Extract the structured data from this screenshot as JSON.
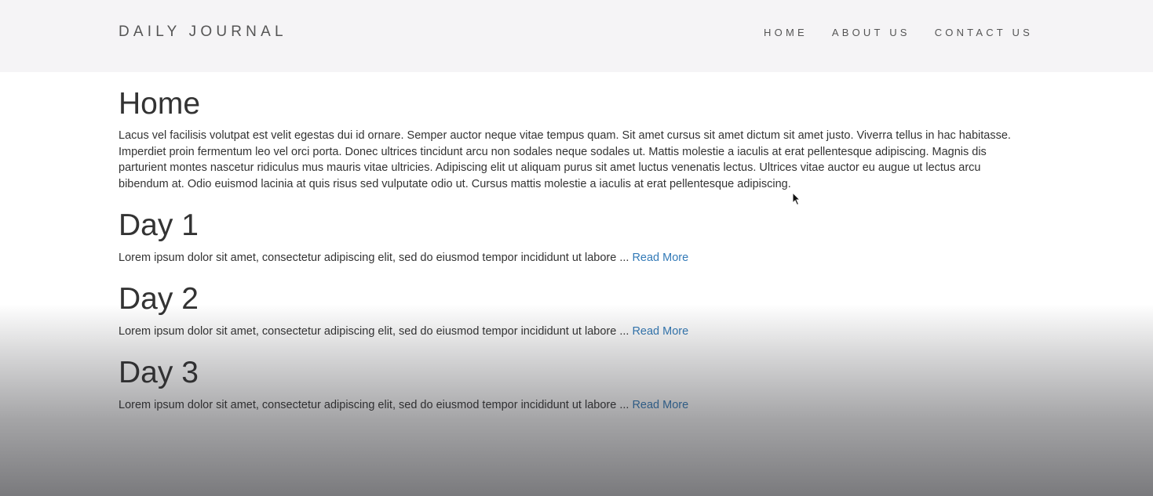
{
  "navbar": {
    "brand": "DAILY JOURNAL",
    "links": [
      "HOME",
      "ABOUT US",
      "CONTACT US"
    ]
  },
  "home": {
    "title": "Home",
    "text": "Lacus vel facilisis volutpat est velit egestas dui id ornare. Semper auctor neque vitae tempus quam. Sit amet cursus sit amet dictum sit amet justo. Viverra tellus in hac habitasse. Imperdiet proin fermentum leo vel orci porta. Donec ultrices tincidunt arcu non sodales neque sodales ut. Mattis molestie a iaculis at erat pellentesque adipiscing. Magnis dis parturient montes nascetur ridiculus mus mauris vitae ultricies. Adipiscing elit ut aliquam purus sit amet luctus venenatis lectus. Ultrices vitae auctor eu augue ut lectus arcu bibendum at. Odio euismod lacinia at quis risus sed vulputate odio ut. Cursus mattis molestie a iaculis at erat pellentesque adipiscing."
  },
  "posts": [
    {
      "title": "Day 1",
      "excerpt": "Lorem ipsum dolor sit amet, consectetur adipiscing elit, sed do eiusmod tempor incididunt ut labore ...",
      "link_label": "Read More"
    },
    {
      "title": "Day 2",
      "excerpt": "Lorem ipsum dolor sit amet, consectetur adipiscing elit, sed do eiusmod tempor incididunt ut labore ...",
      "link_label": "Read More"
    },
    {
      "title": "Day 3",
      "excerpt": "Lorem ipsum dolor sit amet, consectetur adipiscing elit, sed do eiusmod tempor incididunt ut labore ...",
      "link_label": "Read More"
    }
  ],
  "colors": {
    "navbar_bg": "#f5f4f6",
    "text": "#333333",
    "link": "#337ab7"
  },
  "icons": {
    "cursor": "mouse-pointer-icon"
  }
}
